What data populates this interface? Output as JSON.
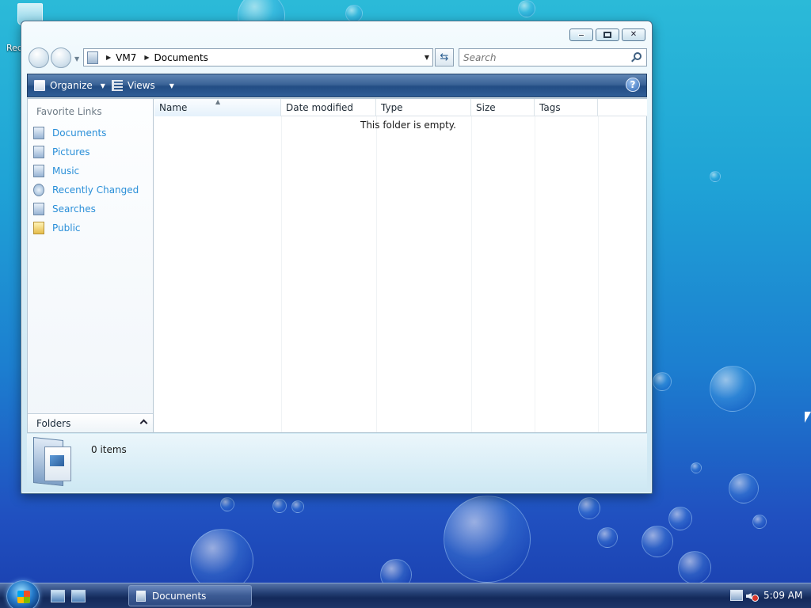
{
  "desktop": {
    "recycle_bin_label": "Recycle Bin"
  },
  "window": {
    "title": "Documents",
    "address": {
      "breadcrumbs": [
        "VM7",
        "Documents"
      ]
    },
    "search": {
      "placeholder": "Search"
    },
    "toolbar": {
      "organize_label": "Organize",
      "views_label": "Views",
      "help_label": "?"
    },
    "nav_pane": {
      "title": "Favorite Links",
      "items": [
        {
          "label": "Documents",
          "icon": "documents-icon"
        },
        {
          "label": "Pictures",
          "icon": "pictures-icon"
        },
        {
          "label": "Music",
          "icon": "music-icon"
        },
        {
          "label": "Recently Changed",
          "icon": "recently-changed-icon"
        },
        {
          "label": "Searches",
          "icon": "searches-icon"
        },
        {
          "label": "Public",
          "icon": "public-folder-icon"
        }
      ],
      "folders_label": "Folders"
    },
    "columns": [
      "Name",
      "Date modified",
      "Type",
      "Size",
      "Tags"
    ],
    "empty_message": "This folder is empty.",
    "details": {
      "item_count": "0 items"
    }
  },
  "taskbar": {
    "task_button_label": "Documents",
    "clock": "5:09 AM"
  }
}
